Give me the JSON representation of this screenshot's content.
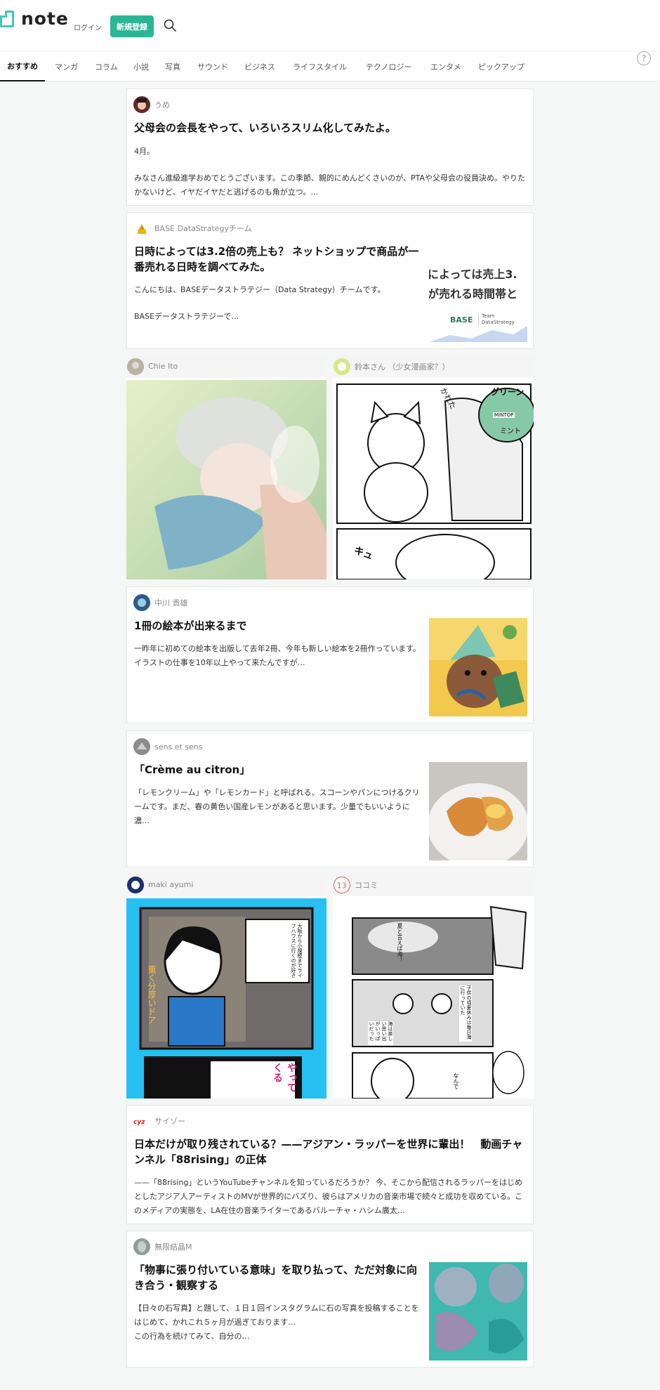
{
  "header": {
    "logo": "note",
    "login": "ログイン",
    "signup": "新規登録"
  },
  "nav": {
    "tabs": [
      "おすすめ",
      "マンガ",
      "コラム",
      "小説",
      "写真",
      "サウンド",
      "ビジネス",
      "ライフスタイル",
      "テクノロジー",
      "エンタメ",
      "ピックアップ"
    ],
    "help": "?"
  },
  "cards": [
    {
      "author": "うめ",
      "title": "父母会の会長をやって、いろいろスリム化してみたよ。",
      "excerpt1": "4月。",
      "excerpt2": "みなさん進級進学おめでとうございます。この季節、親的にめんどくさいのが、PTAや父母会の役員決め。やりたかないけど、イヤだイヤだと逃げるのも角が立つ。…"
    },
    {
      "author": "BASE DataStrategyチーム",
      "title": "日時によっては3.2倍の売上も？ ネットショップで商品が一番売れる日時を調べてみた。",
      "excerpt1": "こんにちは、BASEデータストラテジー（Data Strategy）チームです。",
      "excerpt2": "BASEデータストラテジーで…",
      "thumb_line1": "によっては売上3.",
      "thumb_line2": "が売れる時間帯と",
      "thumb_logo": "BASE",
      "thumb_team": "Team DataStrategy"
    },
    {
      "author": "中川 貴雄",
      "title": "1冊の絵本が出来るまで",
      "excerpt": "一昨年に初めての絵本を出版して去年2冊、今年も新しい絵本を2冊作っています。\nイラストの仕事を10年以上やって来たんですが…"
    },
    {
      "author": "sens et sens",
      "title": "「Crème au citron」",
      "excerpt": "「レモンクリーム」や「レモンカード」と呼ばれる、スコーンやパンにつけるクリームです。まだ、春の黄色い国産レモンがあると思います。少量でもいいように濃…"
    },
    {
      "author": "サイゾー",
      "title": "日本だけが取り残されている？——アジアン・ラッパーを世界に輩出！　動画チャンネル「88rising」の正体",
      "excerpt": "——「88rising」というYouTubeチャンネルを知っているだろうか？ 今、そこから配信されるラッパーをはじめとしたアジア人アーティストのMVが世界的にバズり、彼らはアメリカの音楽市場で続々と成功を収めている。このメディアの実態を、LA在住の音楽ライターであるバルーチャ・ハシム廣太…"
    },
    {
      "author": "無限結晶M",
      "title": "「物事に張り付いている意味」を取り払って、ただ対象に向き合う・観察する",
      "excerpt": "【日々の石写真】と題して、１日１回インスタグラムに石の写真を投稿することをはじめて、かれこれ５ヶ月が過ぎております…\nこの行為を続けてみて、自分の…"
    }
  ],
  "image_cards": [
    {
      "author": "Chie Ito"
    },
    {
      "author": "鈴本さん （少女漫画家？）",
      "manga_text1": "グリーン",
      "manga_text2": "MINTOP",
      "manga_text3": "ミント",
      "manga_text4": "かれた",
      "manga_text5": "キュ"
    },
    {
      "author": "maki ayumi",
      "manga_text1": "重く分厚いドア",
      "manga_text2": "大阪から小規模までライブハウスに行くのが好き",
      "manga_text3": "やってくる"
    },
    {
      "author": "ココミ",
      "manga_text1": "夏と言えば海！",
      "manga_text2": "子供の頃夏休みは毎日海に行っていた",
      "manga_text3": "海は楽しい思い出がいっぱいだった",
      "manga_text4": "なんで"
    }
  ],
  "colors": {
    "accent": "#2cb696",
    "logo": "#41c9b4"
  }
}
